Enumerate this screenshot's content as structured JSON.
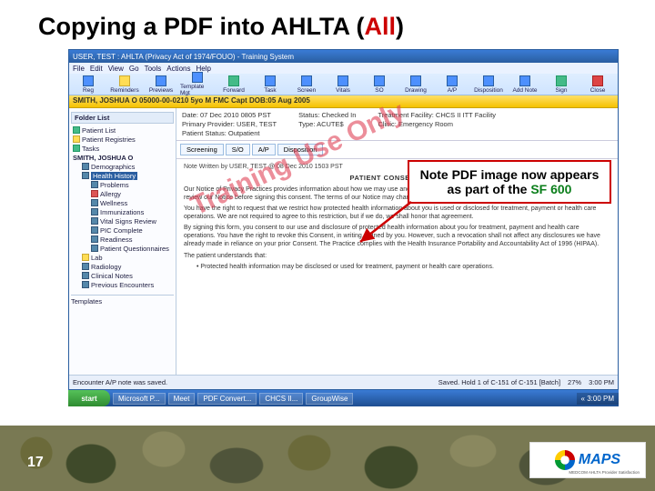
{
  "slide": {
    "title_pre": "Copying a PDF into AHLTA (",
    "title_all": "All",
    "title_post": ")",
    "page_number": "17",
    "logo_text": "MAPS",
    "logo_sub": "MEDCOM AHLTA Provider Satisfaction"
  },
  "callout": {
    "line1": "Note PDF image now",
    "line2": "appears as part of the",
    "line3_green": "SF 600"
  },
  "watermark": "Training Use Only",
  "app": {
    "titlebar": "USER, TEST : AHLTA (Privacy Act of 1974/FOUO) - Training System",
    "menubar": [
      "File",
      "Edit",
      "View",
      "Go",
      "Tools",
      "Actions",
      "Help"
    ],
    "toolbar": [
      {
        "label": "Reg",
        "ic": "blue"
      },
      {
        "label": "Reminders",
        "ic": "yellow"
      },
      {
        "label": "Previews",
        "ic": "blue"
      },
      {
        "label": "Template Mgt",
        "ic": "blue"
      },
      {
        "label": "Forward",
        "ic": "green"
      },
      {
        "label": "Task",
        "ic": "blue"
      },
      {
        "label": "Screen",
        "ic": "blue"
      },
      {
        "label": "Vitals",
        "ic": "blue"
      },
      {
        "label": "SO",
        "ic": "blue"
      },
      {
        "label": "Drawing",
        "ic": "blue"
      },
      {
        "label": "A/P",
        "ic": "blue"
      },
      {
        "label": "Disposition",
        "ic": "blue"
      },
      {
        "label": "Add Note",
        "ic": "blue"
      },
      {
        "label": "Sign",
        "ic": "green"
      },
      {
        "label": "Close",
        "ic": "red"
      }
    ],
    "patientbar": "SMITH, JOSHUA O  05000-00-0210  5yo M  FMC Capt  DOB:05 Aug 2005",
    "sidebar_title": "Folder List",
    "tree": [
      {
        "lvl": 0,
        "ic": "g",
        "label": "Patient List"
      },
      {
        "lvl": 0,
        "ic": "y",
        "label": "Patient Registries"
      },
      {
        "lvl": 0,
        "ic": "g",
        "label": "Tasks"
      },
      {
        "lvl": 0,
        "ic": "",
        "label": "SMITH, JOSHUA O",
        "bold": true
      },
      {
        "lvl": 1,
        "ic": "b",
        "label": "Demographics"
      },
      {
        "lvl": 1,
        "ic": "b",
        "label": "Health History",
        "sel": true
      },
      {
        "lvl": 2,
        "ic": "b",
        "label": "Problems"
      },
      {
        "lvl": 2,
        "ic": "r",
        "label": "Allergy"
      },
      {
        "lvl": 2,
        "ic": "b",
        "label": "Wellness"
      },
      {
        "lvl": 2,
        "ic": "b",
        "label": "Immunizations"
      },
      {
        "lvl": 2,
        "ic": "b",
        "label": "Vital Signs Review"
      },
      {
        "lvl": 2,
        "ic": "b",
        "label": "PIC Complete"
      },
      {
        "lvl": 2,
        "ic": "b",
        "label": "Readiness"
      },
      {
        "lvl": 2,
        "ic": "b",
        "label": "Patient Questionnaires"
      },
      {
        "lvl": 1,
        "ic": "y",
        "label": "Lab"
      },
      {
        "lvl": 1,
        "ic": "b",
        "label": "Radiology"
      },
      {
        "lvl": 1,
        "ic": "b",
        "label": "Clinical Notes"
      },
      {
        "lvl": 1,
        "ic": "b",
        "label": "Previous Encounters"
      }
    ],
    "sidebar_bottom": "Templates",
    "meta": {
      "c1a": "Date: 07 Dec 2010 0805 PST",
      "c1b": "Primary Provider: USER, TEST",
      "c1c": "Patient Status: Outpatient",
      "c2a": "Status: Checked In",
      "c2b": "Type: ACUTE$",
      "c3a": "Treatment Facility: CHCS II ITT Facility",
      "c3b": "Clinic: Emergency Room"
    },
    "tabs": [
      "Screening",
      "S/O",
      "A/P",
      "Disposition"
    ],
    "note": {
      "writer": "Note Written by USER, TEST @ 08 Dec 2010 1503 PST",
      "form_title": "PATIENT CONSENT FORM",
      "p1": "Our Notice of Privacy Practices provides information about how we may use and disclose protected health information about you. You have the right to review our Notice before signing this consent. The terms of our Notice may change. A revised copy may be obtained by forwarding a written request.",
      "p2": "You have the right to request that we restrict how protected health information about you is used or disclosed for treatment, payment or health care operations. We are not required to agree to this restriction, but if we do, we shall honor that agreement.",
      "p3": "By signing this form, you consent to our use and disclosure of protected health information about you for treatment, payment and health care operations. You have the right to revoke this Consent, in writing, signed by you. However, such a revocation shall not affect any disclosures we have already made in reliance on your prior Consent. The Practice complies with the Health Insurance Portability and Accountability Act of 1996 (HIPAA).",
      "p4": "The patient understands that:",
      "b1": "• Protected health information may be disclosed or used for treatment, payment or health care operations."
    },
    "status_l": "Encounter A/P note was saved.",
    "status_r1": "Saved. Hold 1 of C-151 of C-151 [Batch]",
    "status_r2": "27%",
    "status_r3": "3:00 PM"
  },
  "taskbar": {
    "start": "start",
    "items": [
      "Microsoft P...",
      "Meet",
      "PDF Convert...",
      "CHCS II...",
      "GroupWise"
    ],
    "tray": "« 3:00 PM"
  }
}
